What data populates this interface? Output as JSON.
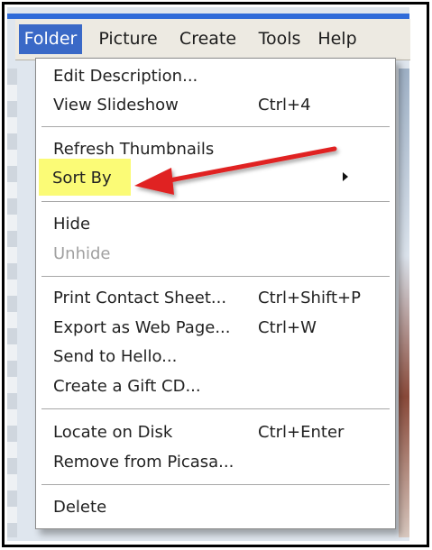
{
  "menubar": {
    "items": [
      {
        "label": "Folder",
        "active": true
      },
      {
        "label": "Picture",
        "active": false
      },
      {
        "label": "Create",
        "active": false
      },
      {
        "label": "Tools",
        "active": false
      },
      {
        "label": "Help",
        "active": false
      }
    ]
  },
  "folder_menu": {
    "groups": [
      [
        {
          "label": "Edit Description...",
          "shortcut": "",
          "enabled": true
        },
        {
          "label": "View Slideshow",
          "shortcut": "Ctrl+4",
          "enabled": true
        }
      ],
      [
        {
          "label": "Refresh Thumbnails",
          "shortcut": "",
          "enabled": true
        },
        {
          "label": "Sort By",
          "shortcut": "",
          "enabled": true,
          "submenu": true,
          "highlighted": true
        }
      ],
      [
        {
          "label": "Hide",
          "shortcut": "",
          "enabled": true
        },
        {
          "label": "Unhide",
          "shortcut": "",
          "enabled": false
        }
      ],
      [
        {
          "label": "Print Contact Sheet...",
          "shortcut": "Ctrl+Shift+P",
          "enabled": true
        },
        {
          "label": "Export as Web Page...",
          "shortcut": "Ctrl+W",
          "enabled": true
        },
        {
          "label": "Send to Hello...",
          "shortcut": "",
          "enabled": true
        },
        {
          "label": "Create a Gift CD...",
          "shortcut": "",
          "enabled": true
        }
      ],
      [
        {
          "label": "Locate on Disk",
          "shortcut": "Ctrl+Enter",
          "enabled": true
        },
        {
          "label": "Remove from Picasa...",
          "shortcut": "",
          "enabled": true
        }
      ],
      [
        {
          "label": "Delete",
          "shortcut": "",
          "enabled": true
        }
      ]
    ]
  },
  "colors": {
    "menu_active_bg": "#3a69c7",
    "highlight": "#fbfb76",
    "annotation_arrow": "#e02020"
  },
  "icons": {
    "submenu": "chevron-right-icon",
    "annotation": "red-arrow-icon"
  }
}
